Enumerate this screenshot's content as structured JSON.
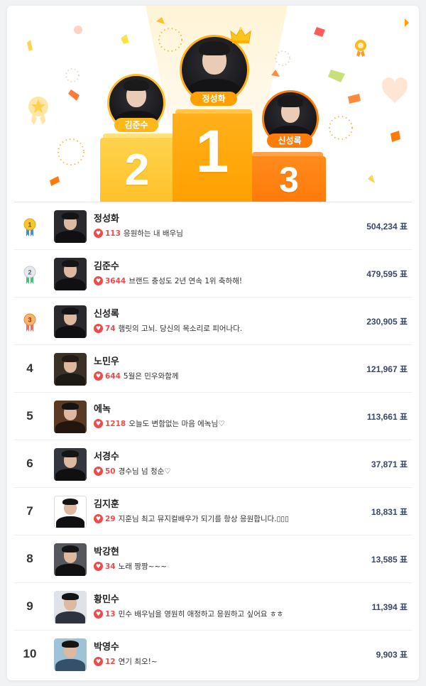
{
  "podium": {
    "first": {
      "name": "정성화",
      "rank_numeral": "1"
    },
    "second": {
      "name": "김준수",
      "rank_numeral": "2"
    },
    "third": {
      "name": "신성록",
      "rank_numeral": "3"
    }
  },
  "colors": {
    "gold": "#ffa000",
    "silver_block": "#ffc12a",
    "bronze_block": "#ff7b0a",
    "heart": "#ef4b4b",
    "votes": "#3a4766"
  },
  "rankings": [
    {
      "rank": "1",
      "medal": "gold-medal-icon",
      "name": "정성화",
      "hearts": "113",
      "message": "응원하는 내 배우님",
      "votes": "504,234 표"
    },
    {
      "rank": "2",
      "medal": "silver-medal-icon",
      "name": "김준수",
      "hearts": "3644",
      "message": "브랜드 충성도 2년 연속 1위 축하해!",
      "votes": "479,595 표"
    },
    {
      "rank": "3",
      "medal": "bronze-medal-icon",
      "name": "신성록",
      "hearts": "74",
      "message": "햄릿의 고뇌. 당신의 목소리로 피어나다.",
      "votes": "230,905 표"
    },
    {
      "rank": "4",
      "name": "노민우",
      "hearts": "644",
      "message": "5월은 민우와함께",
      "votes": "121,967 표"
    },
    {
      "rank": "5",
      "name": "에녹",
      "hearts": "1218",
      "message": "오늘도 변함없는 마음 에녹님♡",
      "votes": "113,661 표"
    },
    {
      "rank": "6",
      "name": "서경수",
      "hearts": "50",
      "message": "경수님 넘 청순♡",
      "votes": "37,871 표"
    },
    {
      "rank": "7",
      "name": "김지훈",
      "hearts": "29",
      "message": "지훈님 최고 뮤지컬배우가 되기를 항상 응원합니다.▯▯▯",
      "votes": "18,831 표"
    },
    {
      "rank": "8",
      "name": "박강현",
      "hearts": "34",
      "message": "노래 짱짱~~~",
      "votes": "13,585 표"
    },
    {
      "rank": "9",
      "name": "황민수",
      "hearts": "13",
      "message": "민수 배우님을 영원히 애정하고 응원하고 싶어요 ㅎㅎ",
      "votes": "11,394 표"
    },
    {
      "rank": "10",
      "name": "박영수",
      "hearts": "12",
      "message": "연기 최오!~",
      "votes": "9,903 표"
    }
  ]
}
